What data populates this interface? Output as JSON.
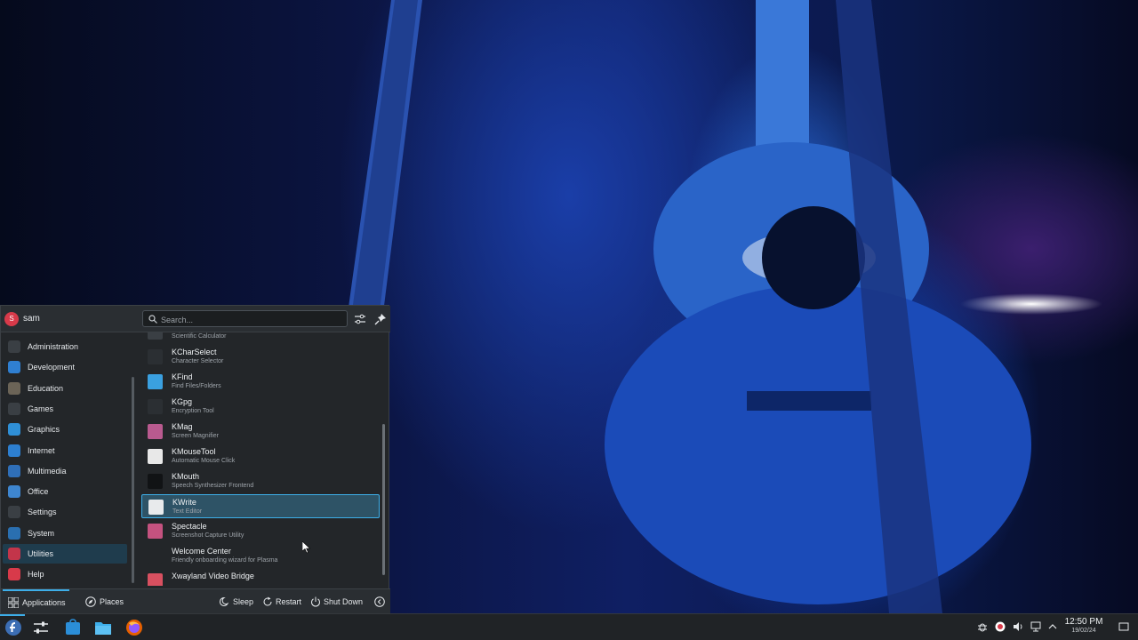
{
  "user": {
    "initial": "S",
    "name": "sam"
  },
  "search": {
    "placeholder": "Search..."
  },
  "categories": [
    {
      "label": "Administration",
      "icon": "administration-icon",
      "color": "#3a3f44"
    },
    {
      "label": "Development",
      "icon": "development-icon",
      "color": "#2f7fd1"
    },
    {
      "label": "Education",
      "icon": "education-icon",
      "color": "#6b6457"
    },
    {
      "label": "Games",
      "icon": "games-icon",
      "color": "#3a3f44"
    },
    {
      "label": "Graphics",
      "icon": "graphics-icon",
      "color": "#2f8fd6"
    },
    {
      "label": "Internet",
      "icon": "internet-icon",
      "color": "#2d7fd0"
    },
    {
      "label": "Multimedia",
      "icon": "multimedia-icon",
      "color": "#2f6fb8"
    },
    {
      "label": "Office",
      "icon": "office-icon",
      "color": "#3e86d0"
    },
    {
      "label": "Settings",
      "icon": "settings-icon",
      "color": "#3a3f44"
    },
    {
      "label": "System",
      "icon": "system-icon",
      "color": "#2a6fb0"
    },
    {
      "label": "Utilities",
      "icon": "utilities-icon",
      "color": "#c3354a"
    },
    {
      "label": "Help",
      "icon": "help-icon",
      "color": "#d83a4a"
    }
  ],
  "selected_category": "Utilities",
  "apps": [
    {
      "title": "",
      "desc": "Scientific Calculator",
      "icon": "calculator-icon",
      "color": "#3a3f44"
    },
    {
      "title": "KCharSelect",
      "desc": "Character Selector",
      "icon": "kcharselect-icon",
      "color": "#2b2f33"
    },
    {
      "title": "KFind",
      "desc": "Find Files/Folders",
      "icon": "kfind-icon",
      "color": "#3aa0e0"
    },
    {
      "title": "KGpg",
      "desc": "Encryption Tool",
      "icon": "kgpg-icon",
      "color": "#2b2f33"
    },
    {
      "title": "KMag",
      "desc": "Screen Magnifier",
      "icon": "kmag-icon",
      "color": "#b95a8f"
    },
    {
      "title": "KMouseTool",
      "desc": "Automatic Mouse Click",
      "icon": "kmousetool-icon",
      "color": "#e8e8e8"
    },
    {
      "title": "KMouth",
      "desc": "Speech Synthesizer Frontend",
      "icon": "kmouth-icon",
      "color": "#111315"
    },
    {
      "title": "KWrite",
      "desc": "Text Editor",
      "icon": "kwrite-icon",
      "color": "#e8eaec"
    },
    {
      "title": "Spectacle",
      "desc": "Screenshot Capture Utility",
      "icon": "spectacle-icon",
      "color": "#c4527f"
    },
    {
      "title": "Welcome Center",
      "desc": "Friendly onboarding wizard for Plasma",
      "icon": "welcome-center-icon",
      "color": "#232629"
    },
    {
      "title": "Xwayland Video Bridge",
      "desc": "",
      "icon": "xwayland-icon",
      "color": "#d85060"
    }
  ],
  "selected_app": "KWrite",
  "footer": {
    "applications": "Applications",
    "places": "Places",
    "sleep": "Sleep",
    "restart": "Restart",
    "shutdown": "Shut Down"
  },
  "clock": {
    "time": "12:50 PM",
    "date": "19/02/24"
  },
  "colors": {
    "accent": "#3daee9",
    "panel": "#232629",
    "taskbar": "#202326"
  }
}
